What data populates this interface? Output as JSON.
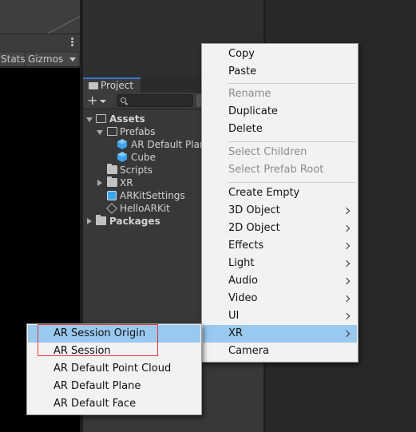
{
  "game_view": {
    "stats_label": "Stats",
    "gizmos_label": "Gizmos"
  },
  "project": {
    "tab_label": "Project",
    "add_label": "+",
    "tree": {
      "assets": "Assets",
      "prefabs": "Prefabs",
      "ar_default_plane": "AR Default Plan",
      "cube": "Cube",
      "scripts": "Scripts",
      "xr": "XR",
      "arkit_settings": "ARKitSettings",
      "hello_arkit": "HelloARKit",
      "packages": "Packages"
    }
  },
  "context_menu": {
    "copy": "Copy",
    "paste": "Paste",
    "rename": "Rename",
    "duplicate": "Duplicate",
    "delete": "Delete",
    "select_children": "Select Children",
    "select_prefab_root": "Select Prefab Root",
    "create_empty": "Create Empty",
    "object_3d": "3D Object",
    "object_2d": "2D Object",
    "effects": "Effects",
    "light": "Light",
    "audio": "Audio",
    "video": "Video",
    "ui": "UI",
    "xr": "XR",
    "camera": "Camera"
  },
  "xr_submenu": {
    "ar_session_origin": "AR Session Origin",
    "ar_session": "AR Session",
    "ar_default_point_cloud": "AR Default Point Cloud",
    "ar_default_plane": "AR Default Plane",
    "ar_default_face": "AR Default Face"
  },
  "colors": {
    "highlight": "#99c9ef",
    "annotation_box": "#e23b3b",
    "tab_accent": "#3a79c7",
    "prefab_icon": "#3ea3ea"
  }
}
